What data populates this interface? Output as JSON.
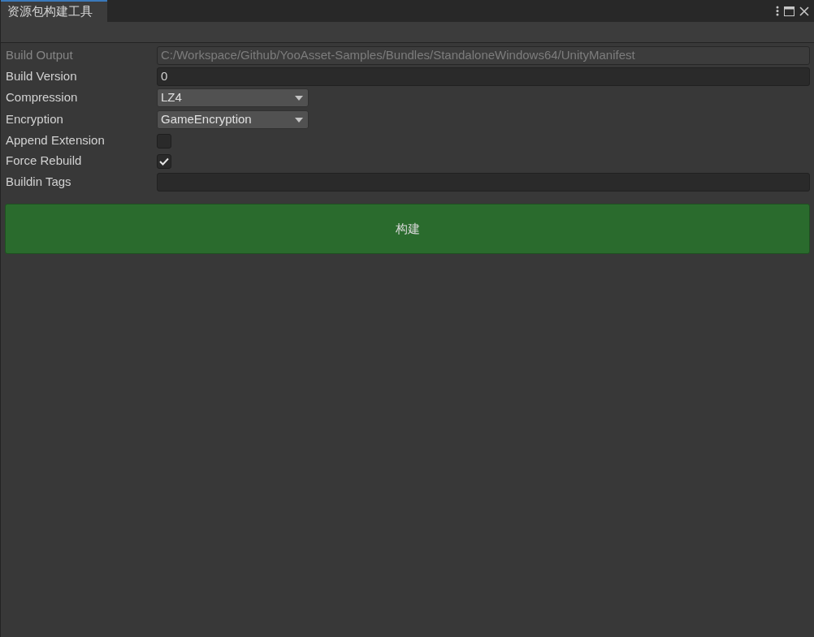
{
  "window": {
    "tab_title": "资源包构建工具"
  },
  "fields": [
    {
      "kind": "text",
      "label": "Build Output",
      "value": "C:/Workspace/Github/YooAsset-Samples/Bundles/StandaloneWindows64/UnityManifest",
      "disabled": true
    },
    {
      "kind": "text",
      "label": "Build Version",
      "value": "0",
      "disabled": false
    },
    {
      "kind": "dropdown",
      "label": "Compression",
      "value": "LZ4",
      "disabled": false
    },
    {
      "kind": "dropdown",
      "label": "Encryption",
      "value": "GameEncryption",
      "disabled": false
    },
    {
      "kind": "checkbox",
      "label": "Append Extension",
      "checked": false,
      "disabled": false
    },
    {
      "kind": "checkbox",
      "label": "Force Rebuild",
      "checked": true,
      "disabled": false
    },
    {
      "kind": "text",
      "label": "Buildin Tags",
      "disabled": false
    }
  ],
  "build_button": "构建"
}
